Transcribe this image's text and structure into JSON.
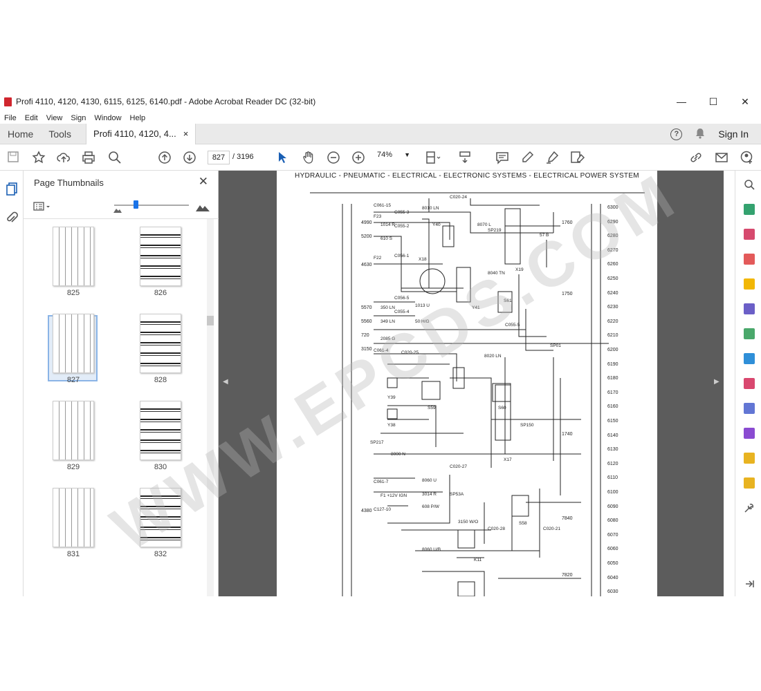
{
  "window": {
    "title": "Profi 4110, 4120, 4130, 6115, 6125, 6140.pdf - Adobe Acrobat Reader DC (32-bit)",
    "minimize": "—",
    "maximize": "☐",
    "close": "✕"
  },
  "menu": [
    "File",
    "Edit",
    "View",
    "Sign",
    "Window",
    "Help"
  ],
  "tabs": {
    "home": "Home",
    "tools": "Tools",
    "doc": "Profi 4110, 4120, 4...",
    "doc_close": "×"
  },
  "header_right": {
    "help": "?",
    "signin": "Sign In"
  },
  "toolbar": {
    "page_current": "827",
    "page_sep": "/",
    "page_total": "3196",
    "zoom": "74%"
  },
  "panel": {
    "title": "Page Thumbnails",
    "close": "✕"
  },
  "thumbnails": [
    {
      "label": "825",
      "style": "diag"
    },
    {
      "label": "826",
      "style": "dense"
    },
    {
      "label": "827",
      "style": "diag",
      "selected": true
    },
    {
      "label": "828",
      "style": "dense"
    },
    {
      "label": "829",
      "style": "diag"
    },
    {
      "label": "830",
      "style": "dense"
    },
    {
      "label": "831",
      "style": "diag"
    },
    {
      "label": "832",
      "style": "dense"
    }
  ],
  "document": {
    "header": "HYDRAULIC - PNEUMATIC - ELECTRICAL - ELECTRONIC SYSTEMS - ELECTRICAL POWER SYSTEM",
    "line_numbers": [
      "6300",
      "6290",
      "6280",
      "6270",
      "6260",
      "6250",
      "6240",
      "6230",
      "6220",
      "6210",
      "6200",
      "6190",
      "6180",
      "6170",
      "6160",
      "6150",
      "6140",
      "6130",
      "6120",
      "6110",
      "6100",
      "6090",
      "6080",
      "6070",
      "6060",
      "6050",
      "6040",
      "6030"
    ],
    "left_refs": [
      "4990",
      "5200",
      "4630",
      "5570",
      "5560",
      "720",
      "3150",
      "4380"
    ],
    "right_refs": [
      "1760",
      "1750",
      "1740",
      "7840",
      "7820"
    ],
    "components": [
      "C061-15",
      "F23",
      "C055-3",
      "C055-2",
      "F22",
      "C056-1",
      "C056-5",
      "C055-4",
      "X18",
      "Y40",
      "C020-24",
      "SP219",
      "X19",
      "S61",
      "C055-5",
      "C061-4",
      "C020-25",
      "Y41",
      "Y39",
      "Y38",
      "S59",
      "S60",
      "X17",
      "C020-27",
      "C061-7",
      "F1 +12V IGN",
      "C127-10",
      "K11",
      "S58",
      "C020-28",
      "C020-21",
      "SP01",
      "SP217",
      "SP53A",
      "SP150"
    ],
    "wires": [
      "8010 LN",
      "1014 R",
      "610 S",
      "1013 U",
      "350 LN",
      "349 LN",
      "50 H/G",
      "2085 G",
      "8020 LN",
      "8000 N",
      "8060 U",
      "3014 R",
      "608 P/W",
      "3150 W/O",
      "8060 U/B",
      "8040 TN",
      "8070 L",
      "57 B"
    ],
    "watermark": "WWW.EPCDS.COM"
  }
}
